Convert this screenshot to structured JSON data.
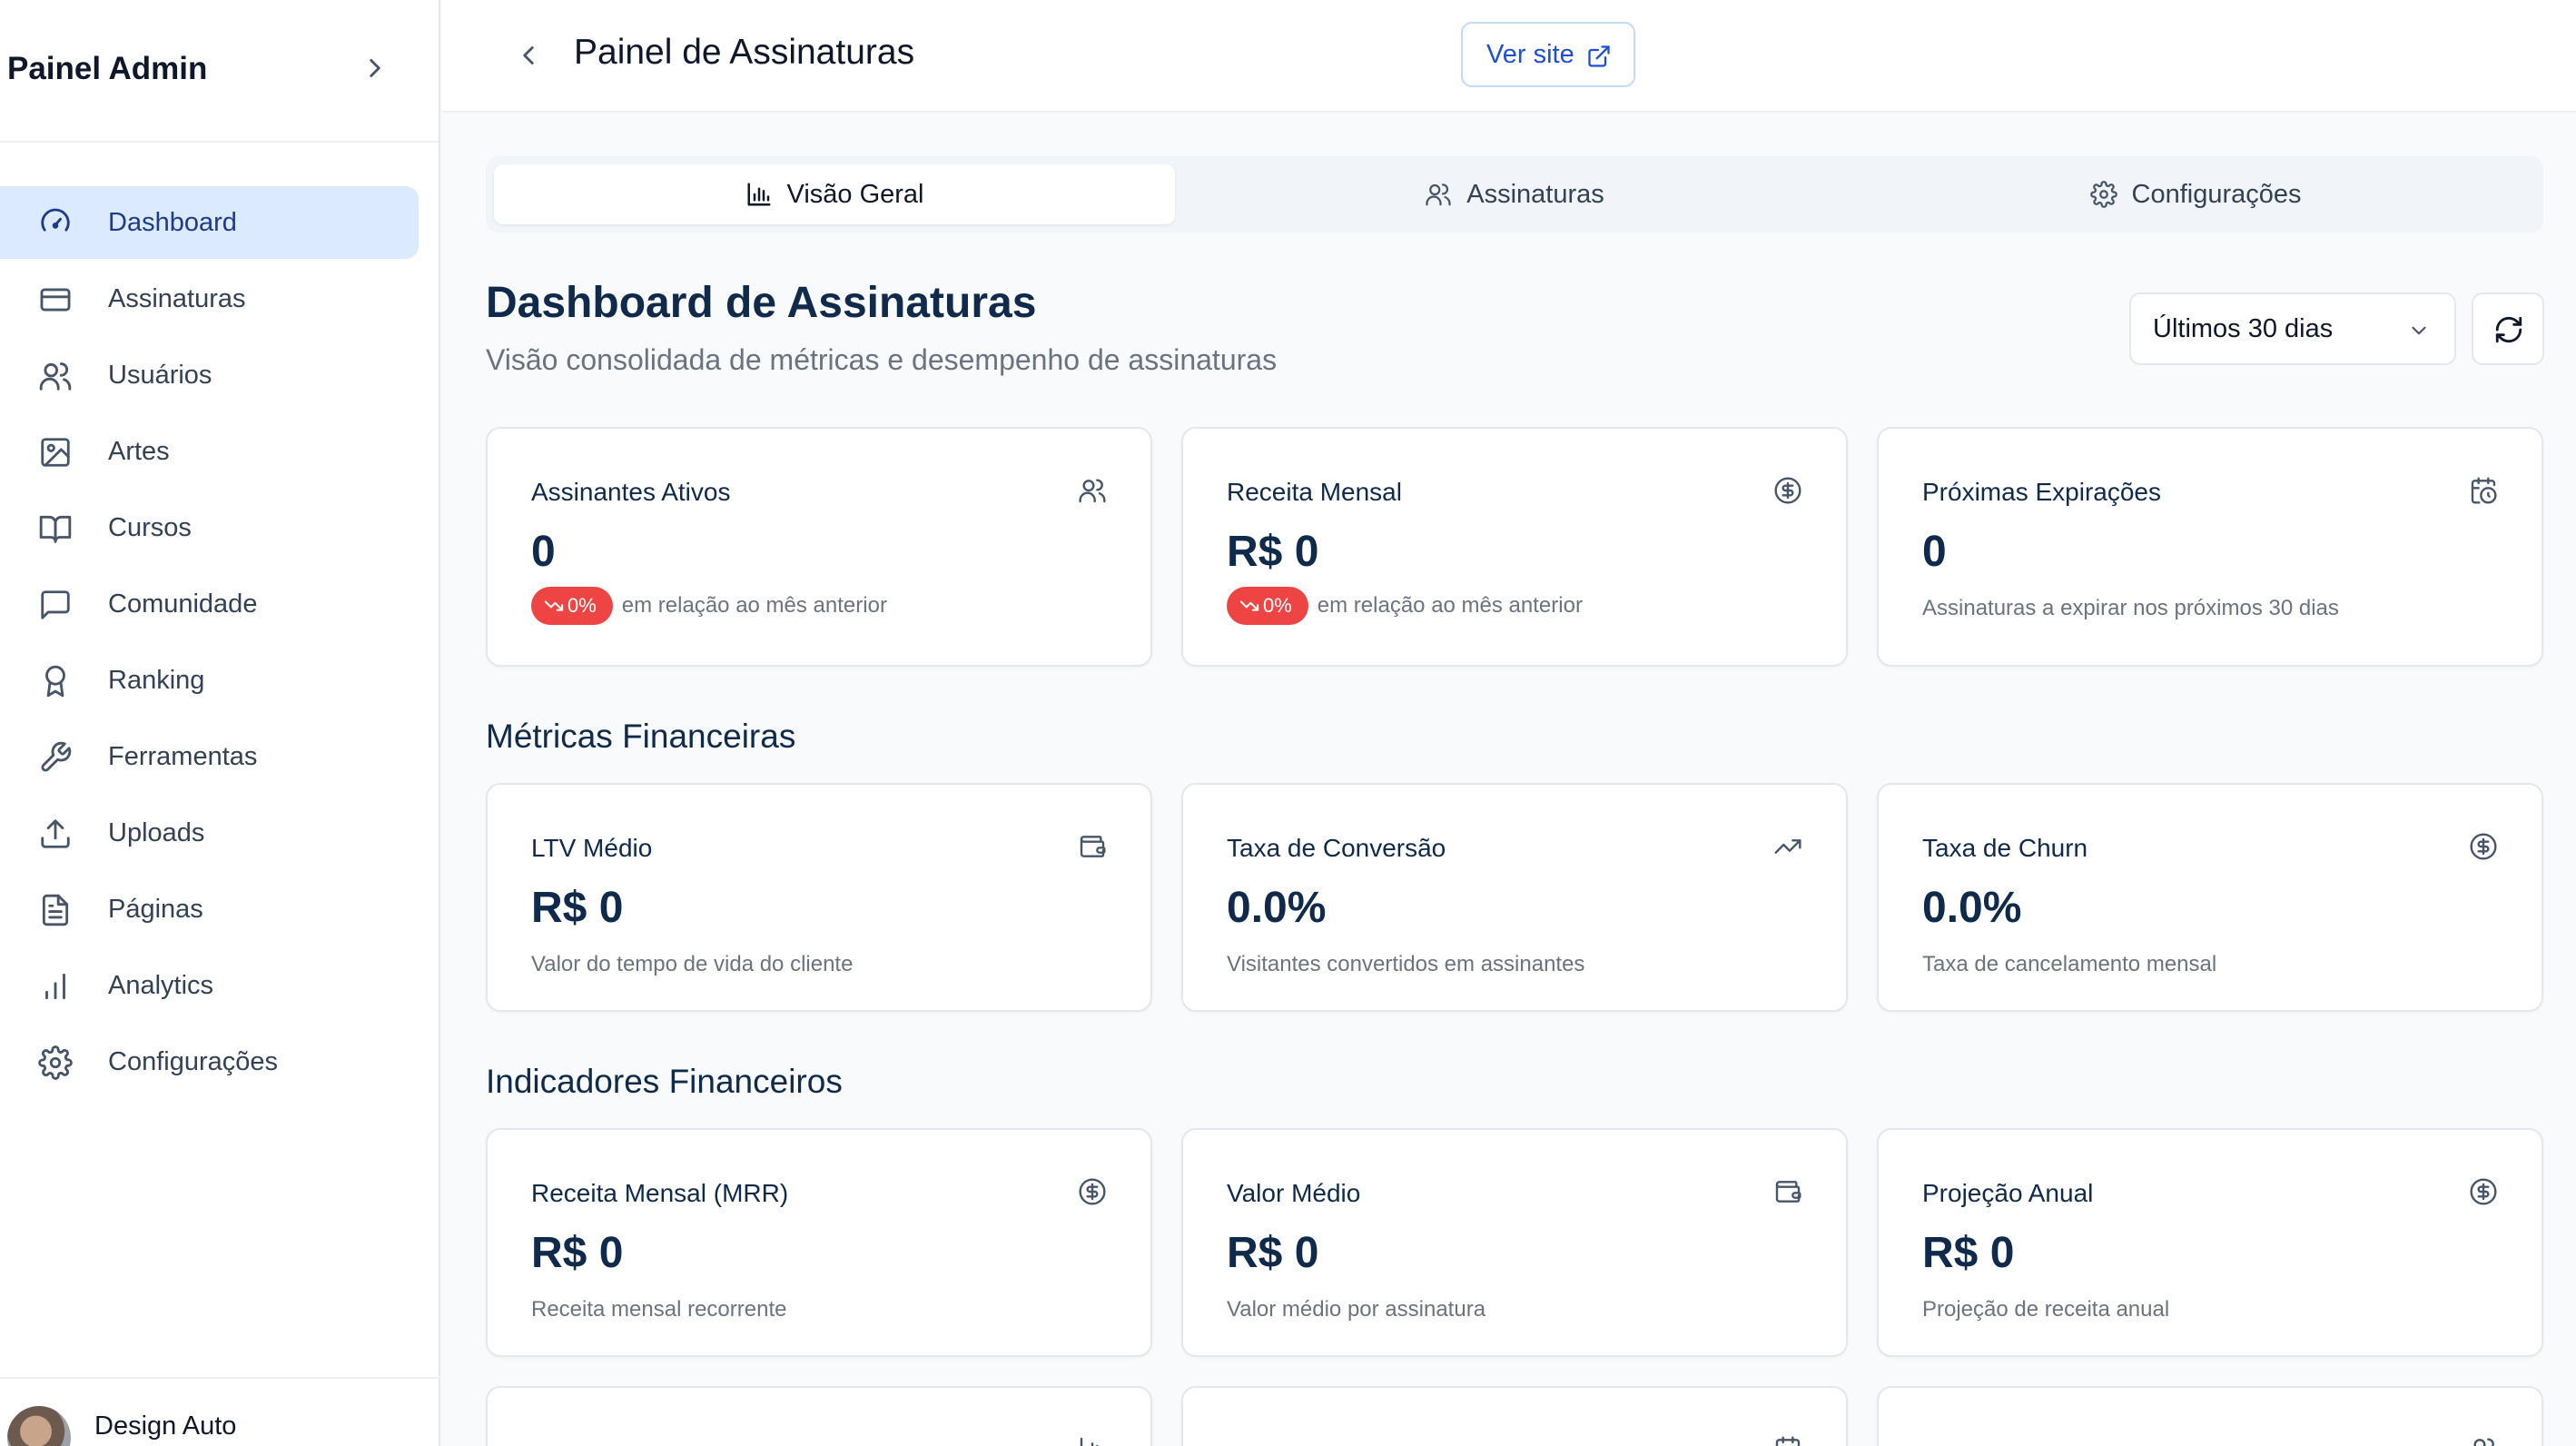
{
  "sidebar": {
    "title": "Painel Admin",
    "items": [
      {
        "label": "Dashboard",
        "icon": "gauge-icon",
        "active": true
      },
      {
        "label": "Assinaturas",
        "icon": "credit-card-icon"
      },
      {
        "label": "Usuários",
        "icon": "users-icon"
      },
      {
        "label": "Artes",
        "icon": "image-icon"
      },
      {
        "label": "Cursos",
        "icon": "book-open-icon"
      },
      {
        "label": "Comunidade",
        "icon": "message-square-icon"
      },
      {
        "label": "Ranking",
        "icon": "award-icon"
      },
      {
        "label": "Ferramentas",
        "icon": "wrench-icon"
      },
      {
        "label": "Uploads",
        "icon": "upload-icon"
      },
      {
        "label": "Páginas",
        "icon": "file-text-icon"
      },
      {
        "label": "Analytics",
        "icon": "bar-chart-icon"
      },
      {
        "label": "Configurações",
        "icon": "gear-icon"
      }
    ],
    "user": {
      "name": "Design Auto"
    }
  },
  "header": {
    "title": "Painel de Assinaturas",
    "ver_site": "Ver site"
  },
  "tabs": [
    {
      "label": "Visão Geral",
      "icon": "bar-chart-icon",
      "active": true
    },
    {
      "label": "Assinaturas",
      "icon": "users-icon"
    },
    {
      "label": "Configurações",
      "icon": "gear-icon"
    }
  ],
  "dashboard": {
    "title": "Dashboard de Assinaturas",
    "subtitle": "Visão consolidada de métricas e desempenho de assinaturas",
    "period": "Últimos 30 dias"
  },
  "top_cards": [
    {
      "title": "Assinantes Ativos",
      "value": "0",
      "badge": "0%",
      "delta_text": "em relação ao mês anterior",
      "icon": "users-icon"
    },
    {
      "title": "Receita Mensal",
      "value": "R$ 0",
      "badge": "0%",
      "delta_text": "em relação ao mês anterior",
      "icon": "dollar-circle-icon"
    },
    {
      "title": "Próximas Expirações",
      "value": "0",
      "desc": "Assinaturas a expirar nos próximos 30 dias",
      "icon": "calendar-clock-icon"
    }
  ],
  "sections": {
    "metricas": "Métricas Financeiras",
    "indicadores": "Indicadores Financeiros"
  },
  "metric_cards": [
    {
      "title": "LTV Médio",
      "value": "R$ 0",
      "desc": "Valor do tempo de vida do cliente",
      "icon": "wallet-icon"
    },
    {
      "title": "Taxa de Conversão",
      "value": "0.0%",
      "desc": "Visitantes convertidos em assinantes",
      "icon": "trending-up-icon"
    },
    {
      "title": "Taxa de Churn",
      "value": "0.0%",
      "desc": "Taxa de cancelamento mensal",
      "icon": "dollar-circle-icon"
    }
  ],
  "indicator_cards": [
    {
      "title": "Receita Mensal (MRR)",
      "value": "R$ 0",
      "desc": "Receita mensal recorrente",
      "icon": "dollar-circle-icon"
    },
    {
      "title": "Valor Médio",
      "value": "R$ 0",
      "desc": "Valor médio por assinatura",
      "icon": "wallet-icon"
    },
    {
      "title": "Projeção Anual",
      "value": "R$ 0",
      "desc": "Projeção de receita anual",
      "icon": "dollar-circle-icon"
    }
  ],
  "colors": {
    "accent": "#1d4ed8",
    "active_bg": "#dbeafe",
    "badge_red": "#ef4444",
    "heading": "#0f2a4a"
  }
}
